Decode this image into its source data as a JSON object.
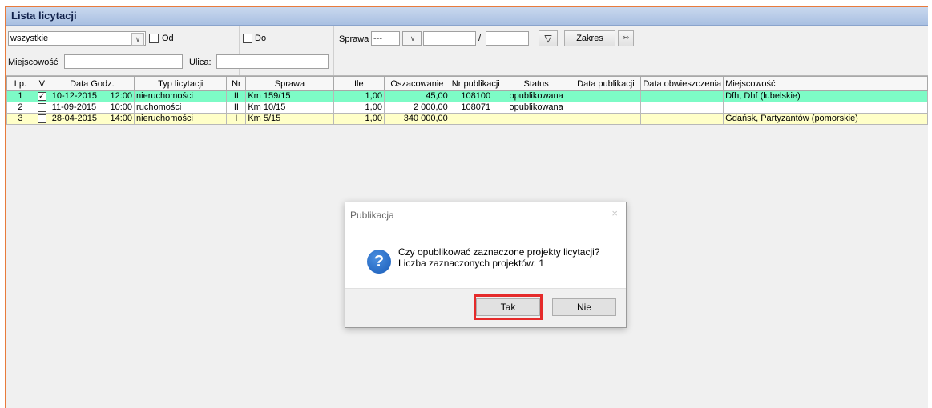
{
  "window": {
    "title": "Lista licytacji"
  },
  "filters": {
    "type_select_value": "wszystkie",
    "od_label": "Od",
    "do_label": "Do",
    "sprawa_label": "Sprawa",
    "sprawa_select_value": "---",
    "slash": "/",
    "zakres_label": "Zakres",
    "miejscowosc_label": "Miejscowość",
    "ulica_label": "Ulica:"
  },
  "table": {
    "headers": [
      "Lp.",
      "V",
      "Data   Godz.",
      "Typ licytacji",
      "Nr",
      "Sprawa",
      "Ile",
      "Oszacowanie",
      "Nr publikacji",
      "Status",
      "Data publikacji",
      "Data obwieszczenia",
      "Miejscowość"
    ],
    "rows": [
      {
        "lp": "1",
        "checked": true,
        "date": "10-12-2015",
        "time": "12:00",
        "type": "nieruchomości",
        "nr": "II",
        "sprawa": "Km 159/15",
        "ile": "1,00",
        "oszacowanie": "45,00",
        "nr_pub": "108100",
        "status": "opublikowana",
        "data_pub": "",
        "data_obw": "",
        "miejscowosc": "Dfh, Dhf (lubelskie)"
      },
      {
        "lp": "2",
        "checked": false,
        "date": "11-09-2015",
        "time": "10:00",
        "type": "ruchomości",
        "nr": "II",
        "sprawa": "Km 10/15",
        "ile": "1,00",
        "oszacowanie": "2 000,00",
        "nr_pub": "108071",
        "status": "opublikowana",
        "data_pub": "",
        "data_obw": "",
        "miejscowosc": ""
      },
      {
        "lp": "3",
        "checked": false,
        "date": "28-04-2015",
        "time": "14:00",
        "type": "nieruchomości",
        "nr": "I",
        "sprawa": "Km 5/15",
        "ile": "1,00",
        "oszacowanie": "340 000,00",
        "nr_pub": "",
        "status": "",
        "data_pub": "",
        "data_obw": "",
        "miejscowosc": "Gdańsk, Partyzantów (pomorskie)"
      }
    ]
  },
  "dialog": {
    "title": "Publikacja",
    "close_glyph": "×",
    "icon_glyph": "?",
    "message_line1": "Czy opublikować zaznaczone projekty licytacji?",
    "message_line2": "Liczba zaznaczonych projektów: 1",
    "yes_label": "Tak",
    "no_label": "Nie"
  },
  "colors": {
    "selected_row": "#7dfbc6",
    "pending_row": "#ffffc8",
    "highlight": "#e52b2b"
  }
}
